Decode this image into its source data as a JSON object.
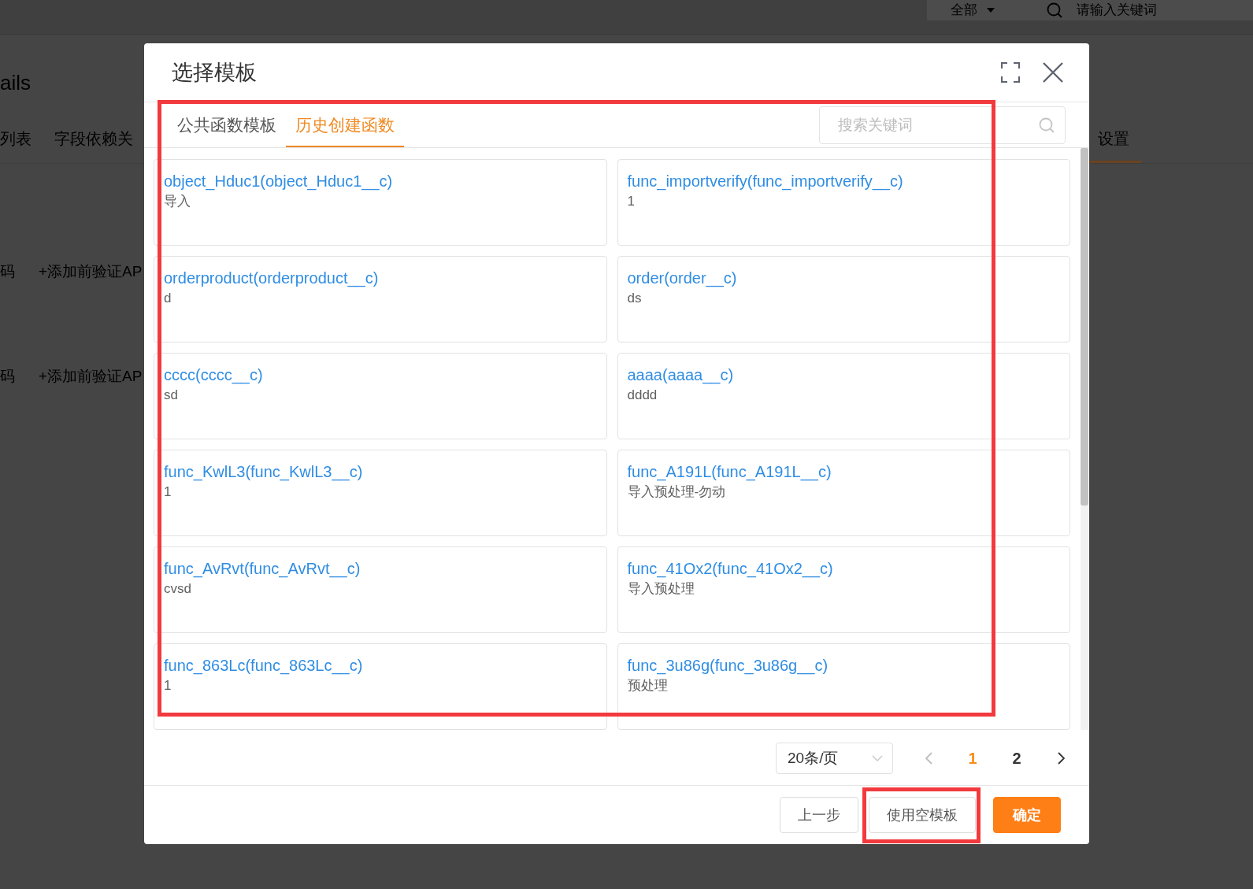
{
  "background_page": {
    "header": {
      "filter": "全部",
      "search_placeholder": "请输入关键词"
    },
    "title": "ails",
    "tabs": [
      {
        "label": "列表",
        "selected": false
      },
      {
        "label": "字段依赖关",
        "selected": false
      },
      {
        "label": "设置",
        "selected": true
      }
    ],
    "rows": [
      {
        "code": "码",
        "action": "+添加前验证AP"
      },
      {
        "code": "码",
        "action": "+添加前验证AP"
      }
    ]
  },
  "dialog": {
    "title": "选择模板",
    "tabs": [
      {
        "label": "公共函数模板",
        "selected": false
      },
      {
        "label": "历史创建函数",
        "selected": true
      }
    ],
    "search": {
      "placeholder": "搜索关键词"
    },
    "content": {
      "highlighted": true
    },
    "templates": [
      {
        "name": "object_Hduc1(object_Hduc1__c)",
        "description": "导入"
      },
      {
        "name": "func_importverify(func_importverify__c)",
        "description": "1"
      },
      {
        "name": "orderproduct(orderproduct__c)",
        "description": "d"
      },
      {
        "name": "order(order__c)",
        "description": "ds"
      },
      {
        "name": "cccc(cccc__c)",
        "description": "sd"
      },
      {
        "name": "aaaa(aaaa__c)",
        "description": "dddd"
      },
      {
        "name": "func_KwlL3(func_KwlL3__c)",
        "description": "1"
      },
      {
        "name": "func_A191L(func_A191L__c)",
        "description": "导入预处理-勿动"
      },
      {
        "name": "func_AvRvt(func_AvRvt__c)",
        "description": "cvsd"
      },
      {
        "name": "func_41Ox2(func_41Ox2__c)",
        "description": "导入预处理"
      },
      {
        "name": "func_863Lc(func_863Lc__c)",
        "description": "1"
      },
      {
        "name": "func_3u86g(func_3u86g__c)",
        "description": "预处理"
      }
    ],
    "pagination": {
      "page_size": "20条/页",
      "pages": [
        {
          "label": "1",
          "selected": true
        },
        {
          "label": "2",
          "selected": false
        }
      ]
    },
    "buttons": [
      {
        "label": "上一步",
        "kind": "default",
        "highlighted": false
      },
      {
        "label": "使用空模板",
        "kind": "default",
        "highlighted": true
      },
      {
        "label": "确定",
        "kind": "primary",
        "highlighted": false
      }
    ]
  }
}
